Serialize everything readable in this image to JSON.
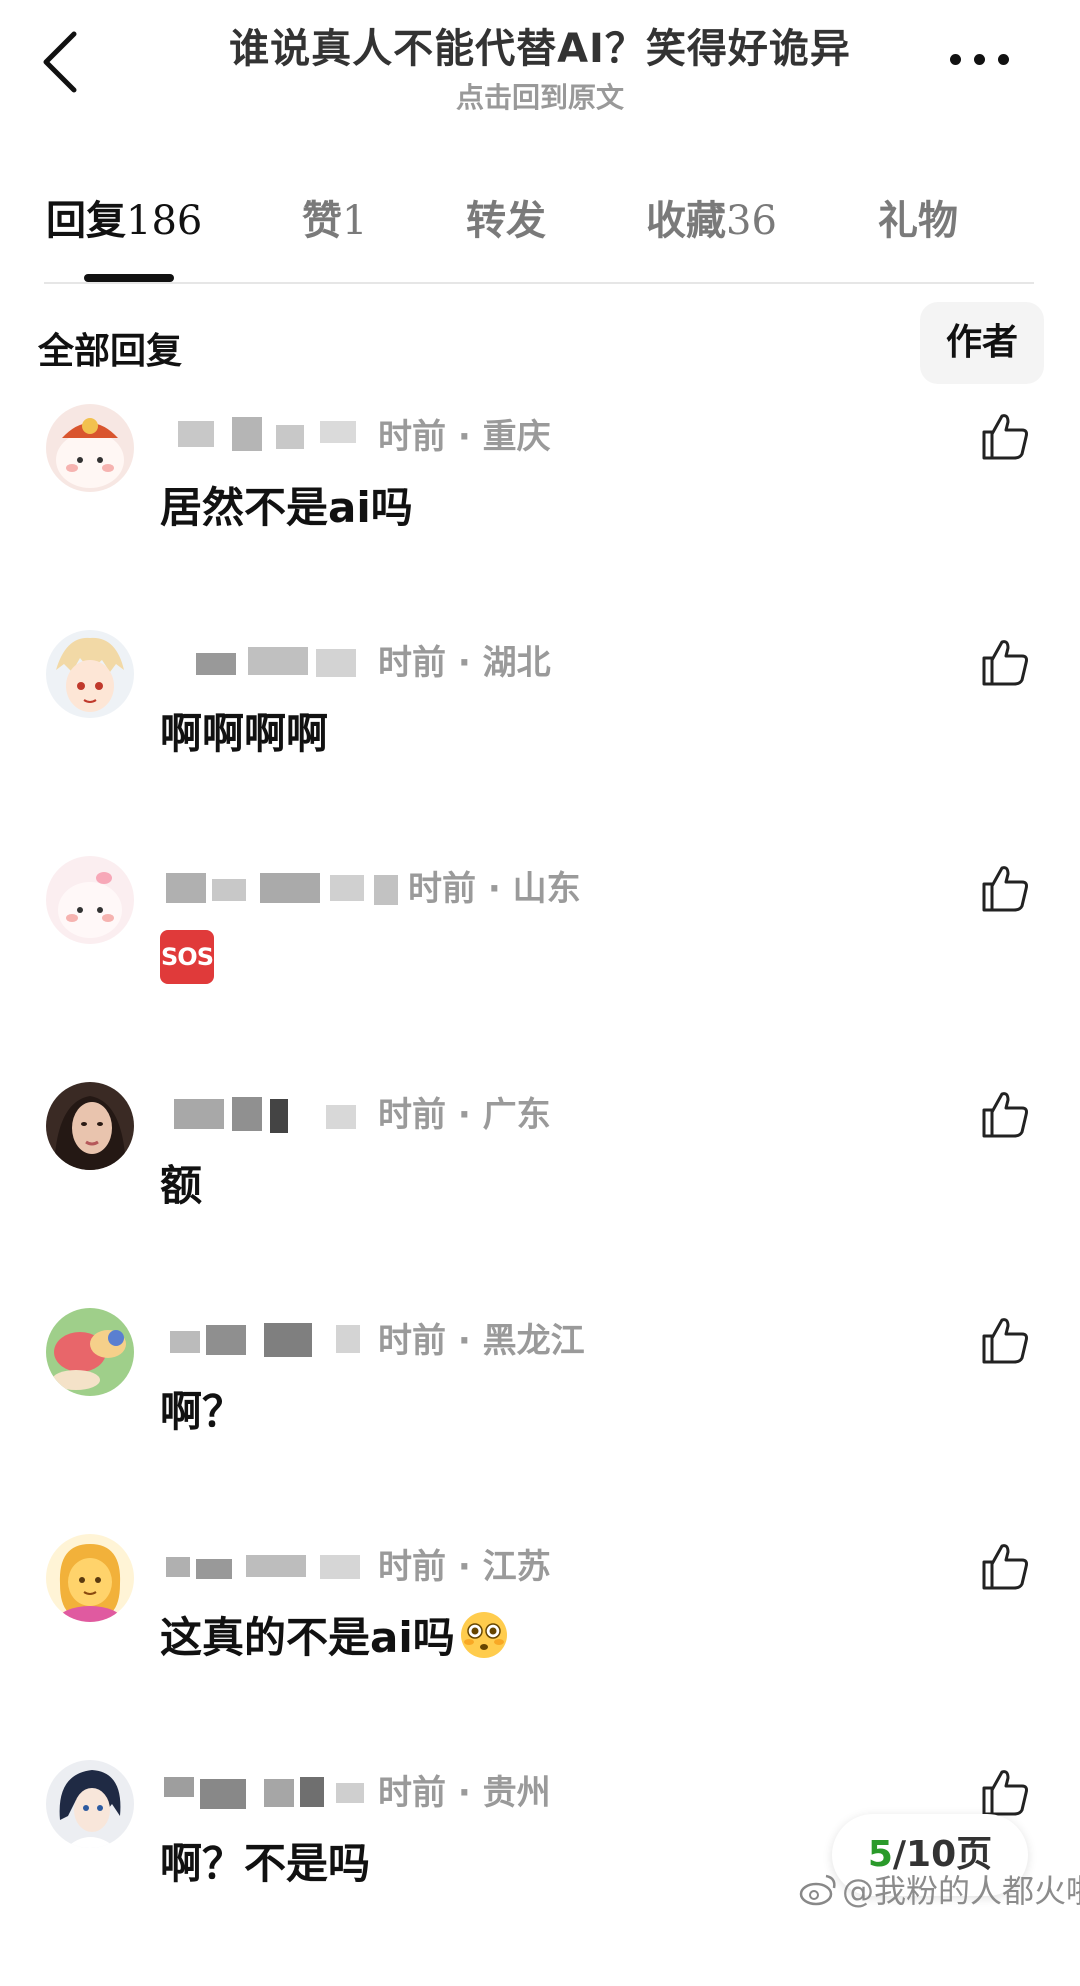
{
  "header": {
    "title": "谁说真人不能代替AI？笑得好诡异",
    "subtitle": "点击回到原文",
    "back_icon": "back-arrow-icon",
    "more_icon": "more-dots-icon"
  },
  "tabs": [
    {
      "label": "回复",
      "count": "186",
      "active": true
    },
    {
      "label": "赞",
      "count": "1",
      "active": false
    },
    {
      "label": "转发",
      "count": "",
      "active": false
    },
    {
      "label": "收藏",
      "count": "36",
      "active": false
    },
    {
      "label": "礼物",
      "count": "",
      "active": false
    }
  ],
  "section": {
    "title": "全部回复",
    "author_filter": "作者"
  },
  "comments": [
    {
      "meta": "时前 · 重庆",
      "text": "居然不是ai吗",
      "avatar": "cartoon-avatar-pink"
    },
    {
      "meta": "时前 · 湖北",
      "text": "啊啊啊啊",
      "avatar": "anime-avatar-blonde"
    },
    {
      "meta": "时前 · 山东",
      "text": "",
      "emoji": "SOS",
      "avatar": "cartoon-avatar-pink"
    },
    {
      "meta": "时前 · 广东",
      "text": "额",
      "avatar": "photo-avatar-woman"
    },
    {
      "meta": "时前 · 黑龙江",
      "text": "啊？",
      "avatar": "cartoon-avatar-colorful"
    },
    {
      "meta": "时前 · 江苏",
      "text": "这真的不是ai吗",
      "emoji": "flushed-face",
      "avatar": "emoji-avatar-woman"
    },
    {
      "meta": "时前 · 贵州",
      "text": "啊？不是吗",
      "avatar": "anime-avatar-dark"
    }
  ],
  "pagination": {
    "current": "5",
    "total_label": "/10页"
  },
  "watermark": "@我粉的人都火啦",
  "colors": {
    "accent_green": "#2a9a2a",
    "sos_red": "#e03a3a",
    "meta_gray": "#9a9a9a"
  }
}
